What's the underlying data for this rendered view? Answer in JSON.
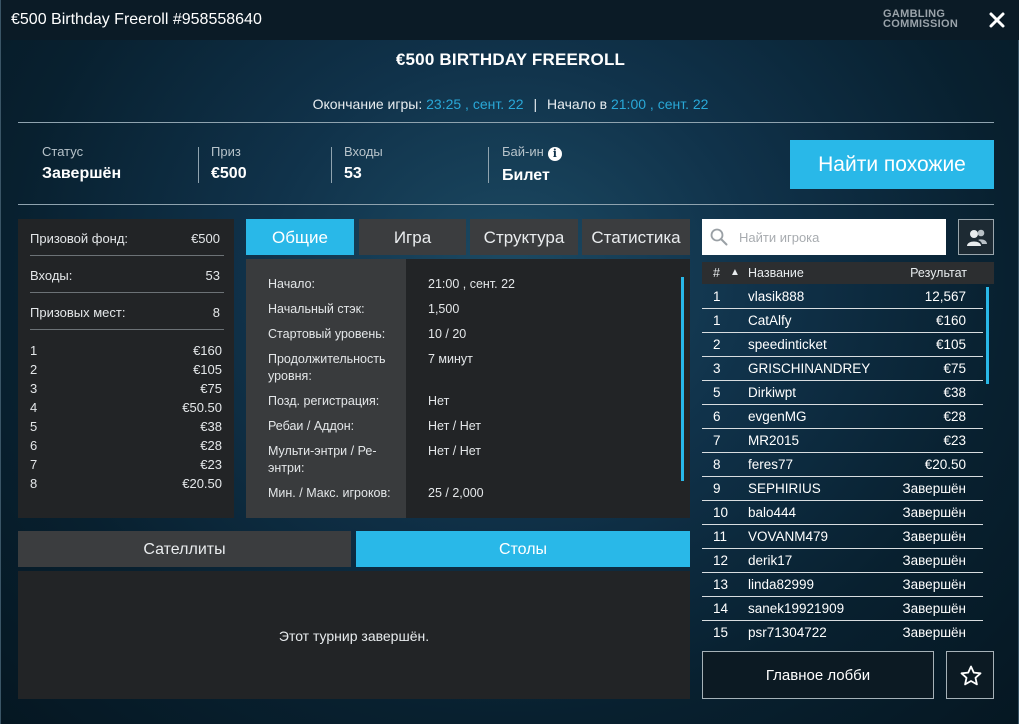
{
  "window": {
    "title": "€500 Birthday Freeroll #958558640",
    "brand_line1": "GAMBLING",
    "brand_line2": "COMMISSION"
  },
  "header": {
    "tournament_name": "€500 BIRTHDAY FREEROLL",
    "end_label": "Окончание игры:",
    "end_value": "23:25 , сент. 22",
    "separator": "|",
    "start_label": "Начало в",
    "start_value": "21:00 , сент. 22"
  },
  "stats": [
    {
      "label": "Статус",
      "value": "Завершён"
    },
    {
      "label": "Приз",
      "value": "€500"
    },
    {
      "label": "Входы",
      "value": "53"
    },
    {
      "label": "Бай-ин",
      "value": "Билет"
    }
  ],
  "info_icon_glyph": "i",
  "find_similar_label": "Найти похожие",
  "prize_panel": {
    "rows": [
      {
        "label": "Призовой фонд:",
        "value": "€500"
      },
      {
        "label": "Входы:",
        "value": "53"
      },
      {
        "label": "Призовых мест:",
        "value": "8"
      }
    ],
    "places": [
      {
        "place": "1",
        "amount": "€160"
      },
      {
        "place": "2",
        "amount": "€105"
      },
      {
        "place": "3",
        "amount": "€75"
      },
      {
        "place": "4",
        "amount": "€50.50"
      },
      {
        "place": "5",
        "amount": "€38"
      },
      {
        "place": "6",
        "amount": "€28"
      },
      {
        "place": "7",
        "amount": "€23"
      },
      {
        "place": "8",
        "amount": "€20.50"
      }
    ]
  },
  "tabs": [
    {
      "label": "Общие",
      "active": true
    },
    {
      "label": "Игра",
      "active": false
    },
    {
      "label": "Структура",
      "active": false
    },
    {
      "label": "Статистика",
      "active": false
    }
  ],
  "details": [
    {
      "key": "Начало:",
      "value": "21:00 , сент. 22"
    },
    {
      "key": "Начальный стэк:",
      "value": "1,500"
    },
    {
      "key": "Стартовый уровень:",
      "value": "10 / 20"
    },
    {
      "key": "Продолжительность уровня:",
      "value": "7 минут"
    },
    {
      "key": "Позд. регистрация:",
      "value": "Нет"
    },
    {
      "key": "Ребаи / Аддон:",
      "value": "Нет / Нет"
    },
    {
      "key": "Мульти-энтри / Ре-энтри:",
      "value": "Нет / Нет"
    },
    {
      "key": "Мин. / Макс. игроков:",
      "value": "25 / 2,000"
    }
  ],
  "bottom_tabs": [
    {
      "label": "Сателлиты",
      "active": false
    },
    {
      "label": "Столы",
      "active": true
    }
  ],
  "bottom_message": "Этот турнир завершён.",
  "search": {
    "placeholder": "Найти игрока"
  },
  "leaderboard": {
    "col_rank": "#",
    "sort_glyph": "▲",
    "col_name": "Название",
    "col_result": "Результат",
    "rows": [
      {
        "rank": "1",
        "name": "vlasik888",
        "result": "12,567"
      },
      {
        "rank": "1",
        "name": "CatAlfy",
        "result": "€160"
      },
      {
        "rank": "2",
        "name": "speedinticket",
        "result": "€105"
      },
      {
        "rank": "3",
        "name": "GRISCHINANDREY",
        "result": "€75"
      },
      {
        "rank": "5",
        "name": "Dirkiwpt",
        "result": "€38"
      },
      {
        "rank": "6",
        "name": "evgenMG",
        "result": "€28"
      },
      {
        "rank": "7",
        "name": "MR2015",
        "result": "€23"
      },
      {
        "rank": "8",
        "name": "feres77",
        "result": "€20.50"
      },
      {
        "rank": "9",
        "name": "SEPHIRIUS",
        "result": "Завершён"
      },
      {
        "rank": "10",
        "name": "balo444",
        "result": "Завершён"
      },
      {
        "rank": "11",
        "name": "VOVANM479",
        "result": "Завершён"
      },
      {
        "rank": "12",
        "name": "derik17",
        "result": "Завершён"
      },
      {
        "rank": "13",
        "name": "linda82999",
        "result": "Завершён"
      },
      {
        "rank": "14",
        "name": "sanek19921909",
        "result": "Завершён"
      },
      {
        "rank": "15",
        "name": "psr71304722",
        "result": "Завершён"
      }
    ]
  },
  "main_lobby_label": "Главное лобби",
  "colors": {
    "accent": "#29b8e8",
    "link_blue": "#29a8d8",
    "panel": "#222426",
    "tab_inactive": "#3b3d3f"
  },
  "icons": {
    "close": "close-icon",
    "info": "info-icon",
    "search": "search-icon",
    "players": "players-icon",
    "favorite": "star-icon"
  }
}
